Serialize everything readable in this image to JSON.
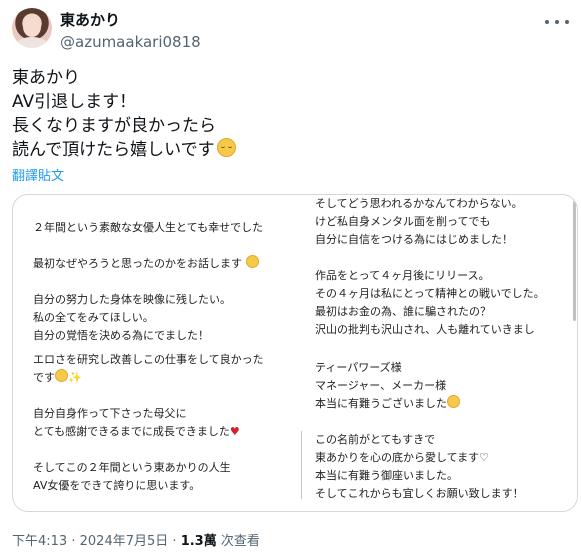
{
  "author": {
    "display_name": "東あかり",
    "handle": "@azumaakari0818"
  },
  "tweet": {
    "lines": [
      "東あかり",
      "AV引退します！",
      "長くなりますが良かったら",
      "読んで頂けたら嬉しいです"
    ],
    "translate_label": "翻譯貼文"
  },
  "image_text": {
    "left_top_cut": "",
    "left": [
      "２年間という素敵な女優人生とても幸せでした",
      "",
      "最初なぜやろうと思ったのかをお話します",
      "",
      "自分の努力した身体を映像に残したい。",
      "私の全てをみてほしい。",
      "自分の覚悟を決める為にでました！",
      "エロさを研究し改善しこの仕事をして良かった",
      "です",
      "",
      "自分自身作って下さった母父に",
      "とても感謝できるまでに成長できました",
      "",
      "そしてこの２年間という東あかりの人生",
      "AV女優をできて誇りに思います。"
    ],
    "right_top": [
      "そしてどう思われるかなんてわからない。",
      "けど私自身メンタル面を削ってでも",
      "自分に自信をつける為にはじめました！",
      "",
      "作品をとって４ヶ月後にリリース。",
      "その４ヶ月は私にとって精神との戦いでした。",
      "最初はお金の為、誰に騙されたの？",
      "沢山の批判も沢山され、人も離れていきまし"
    ],
    "right_bottom": [
      "ティーパワーズ様",
      "マネージャー、メーカー様",
      "本当に有難うございました",
      "",
      "この名前がとてもすきで",
      "東あかりを心の底から愛してます♡",
      "本当に有難う御座いました。",
      "そしてこれからも宜しくお願い致します！"
    ]
  },
  "footer": {
    "time": "下午4:13",
    "separator": "·",
    "date": "2024年7月5日",
    "views_count": "1.3萬",
    "views_label": "次查看"
  },
  "icons": {
    "more": "more-horizontal-icon",
    "emoji": "relieved-face-icon",
    "heart": "red-heart-icon",
    "sparkles": "sparkles-icon"
  },
  "colors": {
    "link": "#1d9bf0",
    "secondary_text": "#536471",
    "border": "#cfd9de"
  }
}
